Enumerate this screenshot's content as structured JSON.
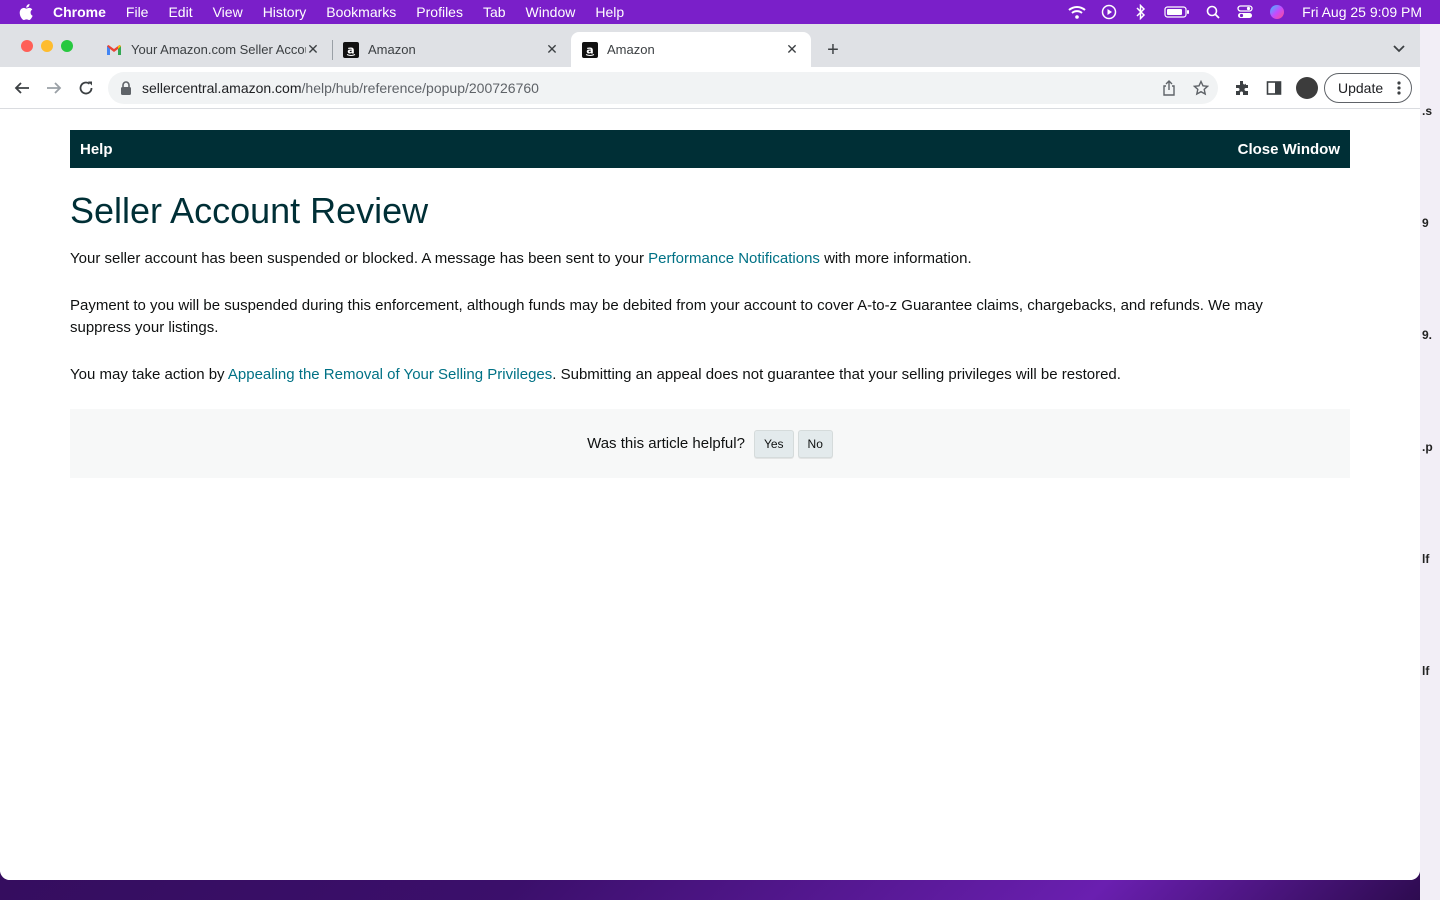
{
  "menubar": {
    "app_name": "Chrome",
    "items": [
      "File",
      "Edit",
      "View",
      "History",
      "Bookmarks",
      "Profiles",
      "Tab",
      "Window",
      "Help"
    ],
    "clock": "Fri Aug 25  9:09 PM"
  },
  "desktop_strip": {
    "fragments": [
      ".s",
      "9",
      "9.",
      ".p",
      "lf",
      "lf"
    ]
  },
  "browser": {
    "tabs": [
      {
        "title": "Your Amazon.com Seller Account",
        "favicon": "gmail-icon"
      },
      {
        "title": "Amazon",
        "favicon": "amazon-icon"
      },
      {
        "title": "Amazon",
        "favicon": "amazon-icon",
        "active": true
      }
    ],
    "url_host": "sellercentral.amazon.com",
    "url_path": "/help/hub/reference/popup/200726760",
    "update_label": "Update"
  },
  "page": {
    "help_label": "Help",
    "close_window_label": "Close Window",
    "title": "Seller Account Review",
    "p1_before": "Your seller account has been suspended or blocked. A message has been sent to your ",
    "p1_link": "Performance Notifications",
    "p1_after": " with more information.",
    "p2": "Payment to you will be suspended during this enforcement, although funds may be debited from your account to cover A-to-z Guarantee claims, chargebacks, and refunds. We may suppress your listings.",
    "p3_before": "You may take action by ",
    "p3_link": "Appealing the Removal of Your Selling Privileges",
    "p3_after": ". Submitting an appeal does not guarantee that your selling privileges will be restored.",
    "feedback_question": "Was this article helpful?",
    "yes_label": "Yes",
    "no_label": "No"
  },
  "colors": {
    "menubar": "#7a1fc9",
    "helpbar": "#002f36",
    "link": "#007185",
    "title": "#002f36"
  }
}
